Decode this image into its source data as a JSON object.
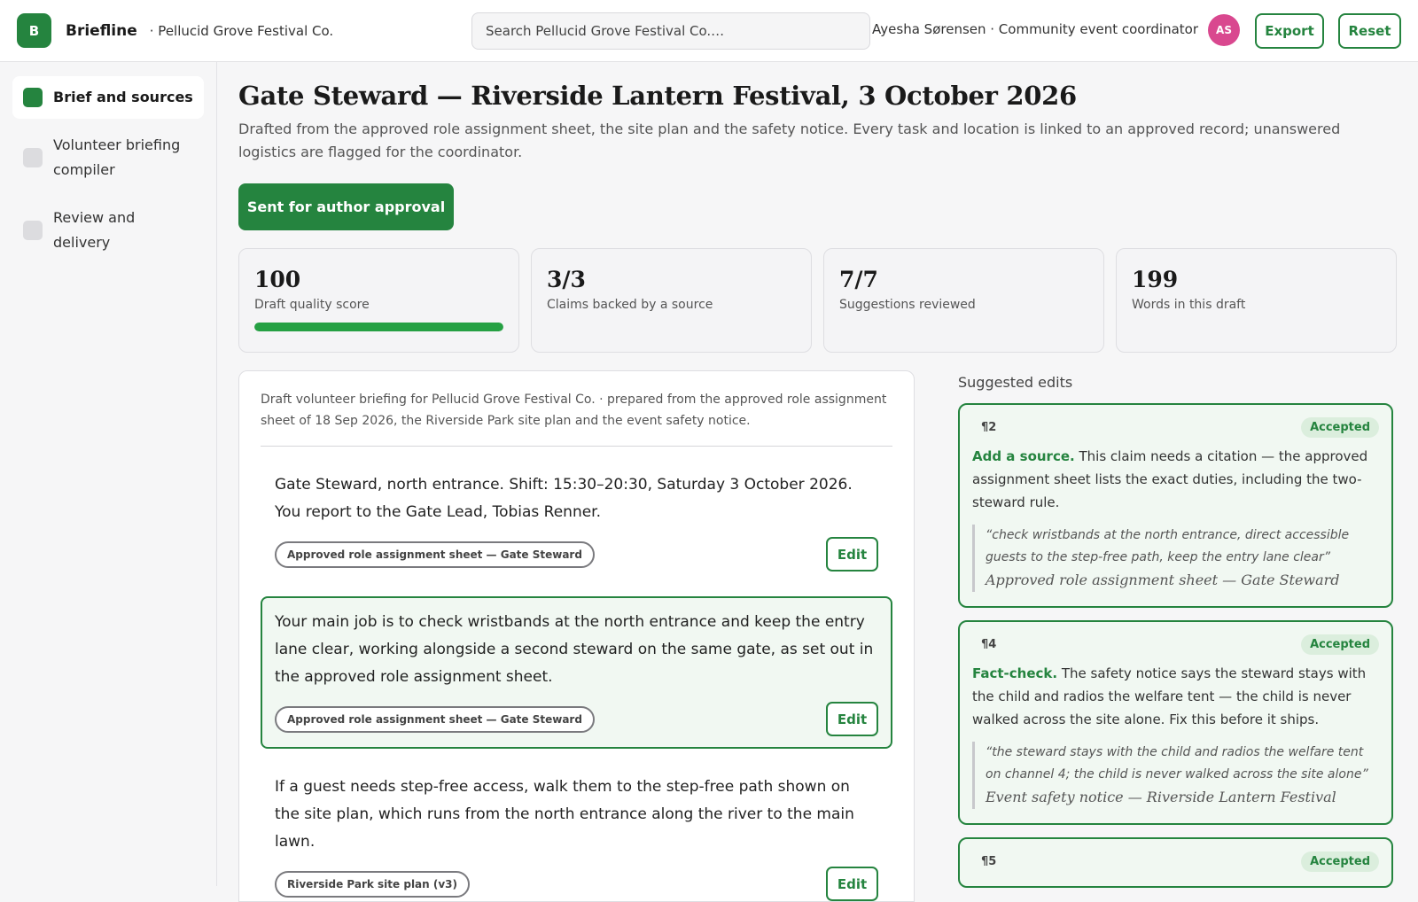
{
  "topbar": {
    "logo_letter": "B",
    "brand": "Briefline",
    "org": "· Pellucid Grove Festival Co.",
    "search_placeholder": "Search Pellucid Grove Festival Co.…",
    "user": "Ayesha Sørensen · Community event coordinator",
    "avatar_initials": "AS",
    "export_label": "Export",
    "reset_label": "Reset"
  },
  "sidebar": {
    "items": [
      {
        "label": "Brief and sources"
      },
      {
        "label": "Volunteer briefing compiler"
      },
      {
        "label": "Review and delivery"
      }
    ]
  },
  "main": {
    "title": "Gate Steward — Riverside Lantern Festival, 3 October 2026",
    "subtitle": "Drafted from the approved role assignment sheet, the site plan and the safety notice. Every task and location is linked to an approved record; unanswered logistics are flagged for the coordinator.",
    "status_button": "Sent for author approval",
    "stats": [
      {
        "value": "100",
        "label": "Draft quality score",
        "progress": 1.0
      },
      {
        "value": "3/3",
        "label": "Claims backed by a source"
      },
      {
        "value": "7/7",
        "label": "Suggestions reviewed"
      },
      {
        "value": "199",
        "label": "Words in this draft"
      }
    ],
    "colors": {
      "accent": "#25843f",
      "progress": "#25a043"
    }
  },
  "doc": {
    "header": "Draft volunteer briefing for Pellucid Grove Festival Co. · prepared from the approved role assignment sheet of 18 Sep 2026, the Riverside Park site plan and the event safety notice.",
    "paragraphs": [
      {
        "text": "Gate Steward, north entrance. Shift: 15:30–20:30, Saturday 3 October 2026. You report to the Gate Lead, Tobias Renner.",
        "source": "Approved role assignment sheet — Gate Steward",
        "edit": "Edit"
      },
      {
        "text": "Your main job is to check wristbands at the north entrance and keep the entry lane clear, working alongside a second steward on the same gate, as set out in the approved role assignment sheet.",
        "source": "Approved role assignment sheet — Gate Steward",
        "edit": "Edit"
      },
      {
        "text": "If a guest needs step-free access, walk them to the step-free path shown on the site plan, which runs from the north entrance along the river to the main lawn.",
        "source": "Riverside Park site plan (v3)",
        "edit": "Edit"
      }
    ]
  },
  "suggestions": {
    "title": "Suggested edits",
    "items": [
      {
        "para": "¶2",
        "status": "Accepted",
        "kind": "Add a source.",
        "body": " This claim needs a citation — the approved assignment sheet lists the exact duties, including the two-steward rule.",
        "quote": "“check wristbands at the north entrance, direct accessible guests to the step-free path, keep the entry lane clear”",
        "quote_source": "Approved role assignment sheet — Gate Steward"
      },
      {
        "para": "¶4",
        "status": "Accepted",
        "kind": "Fact-check.",
        "body": " The safety notice says the steward stays with the child and radios the welfare tent — the child is never walked across the site alone. Fix this before it ships.",
        "quote": "“the steward stays with the child and radios the welfare tent on channel 4; the child is never walked across the site alone”",
        "quote_source": "Event safety notice — Riverside Lantern Festival"
      },
      {
        "para": "¶5",
        "status": "Accepted"
      }
    ]
  }
}
